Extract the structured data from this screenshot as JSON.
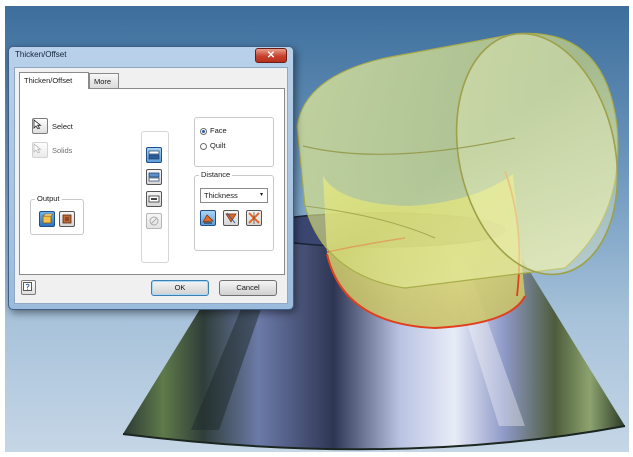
{
  "dialog": {
    "title": "Thicken/Offset",
    "close_glyph": "✕",
    "tabs": [
      {
        "label": "Thicken/Offset",
        "active": true
      },
      {
        "label": "More",
        "active": false
      }
    ],
    "select_label": "Select",
    "solids_label": "Solids",
    "output": {
      "title": "Output"
    },
    "mode": {
      "options": [
        {
          "label": "Face",
          "checked": true
        },
        {
          "label": "Quilt",
          "checked": false
        }
      ]
    },
    "distance": {
      "title": "Distance",
      "selected": "Thickness",
      "caret": "▾"
    },
    "ok_label": "OK",
    "cancel_label": "Cancel",
    "icons": {
      "select": "cursor-arrow-icon",
      "solids": "solids-cursor-icon",
      "output_solid": "solid-output-icon",
      "output_surface": "surface-output-icon",
      "help": "help-icon",
      "join": "join-operation-icon",
      "cut": "cut-operation-icon",
      "intersect": "intersect-operation-icon",
      "new_solid": "new-solid-icon",
      "dir1": "direction-one-icon",
      "dir2": "direction-two-icon",
      "symmetric": "symmetric-direction-icon"
    }
  },
  "colors": {
    "viewport_top": "#3d6e9c",
    "viewport_bottom": "#c5d6e6",
    "offset_surface": "#e7ee8a",
    "highlight_edge": "#e0401f",
    "accent_blue": "#2c5ea3"
  }
}
